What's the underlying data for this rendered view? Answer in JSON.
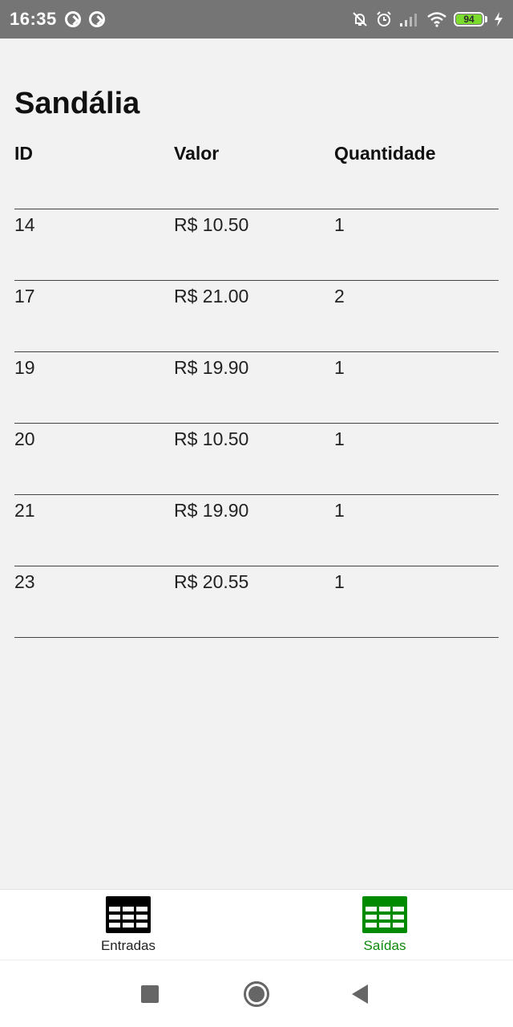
{
  "status_bar": {
    "time": "16:35",
    "battery": "94"
  },
  "page": {
    "title": "Sandália"
  },
  "table": {
    "headers": [
      "ID",
      "Valor",
      "Quantidade"
    ],
    "rows": [
      [
        "14",
        "R$ 10.50",
        "1"
      ],
      [
        "17",
        "R$ 21.00",
        "2"
      ],
      [
        "19",
        "R$ 19.90",
        "1"
      ],
      [
        "20",
        "R$ 10.50",
        "1"
      ],
      [
        "21",
        "R$ 19.90",
        "1"
      ],
      [
        "23",
        "R$ 20.55",
        "1"
      ]
    ]
  },
  "tabs": [
    {
      "label": "Entradas",
      "icon": "table-icon",
      "color": "#000000",
      "active": false
    },
    {
      "label": "Saídas",
      "icon": "table-icon",
      "color": "#008a00",
      "active": true
    }
  ],
  "colors": {
    "status_bar_bg": "#757575",
    "background": "#f2f2f2",
    "accent": "#008a00",
    "battery": "#7bdc2e"
  }
}
